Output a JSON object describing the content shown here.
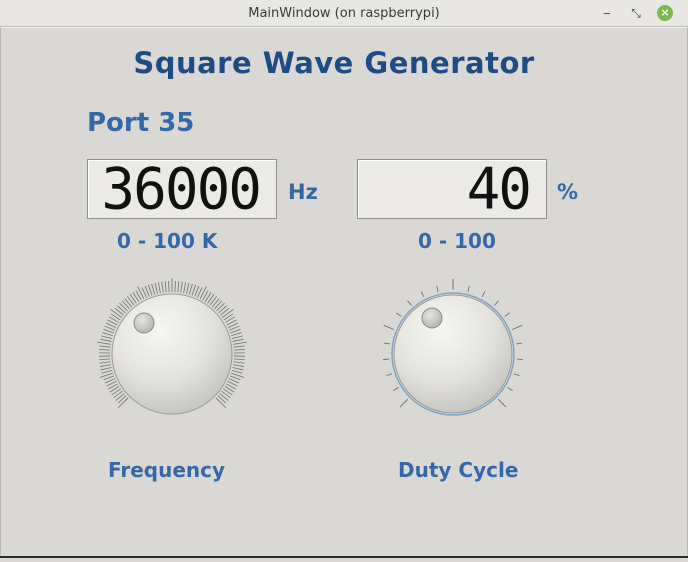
{
  "window": {
    "title": "MainWindow (on raspberrypi)",
    "minimize_glyph": "‒",
    "maximize_glyph": "⤡",
    "close_glyph": "×",
    "close_color": "#7ab94c"
  },
  "main": {
    "title": "Square Wave Generator",
    "port_label": "Port 35",
    "frequency": {
      "display_value": "36000",
      "unit": "Hz",
      "range_label": "0 - 100 K",
      "dial_label": "Frequency",
      "dial_value_fraction": 0.36
    },
    "duty_cycle": {
      "display_value": "40",
      "unit": "%",
      "range_label": "0 - 100",
      "dial_label": "Duty Cycle",
      "dial_value_fraction": 0.4
    }
  },
  "colors": {
    "title": "#1f4b85",
    "labels": "#3468a8",
    "background": "#d9d8d4"
  }
}
